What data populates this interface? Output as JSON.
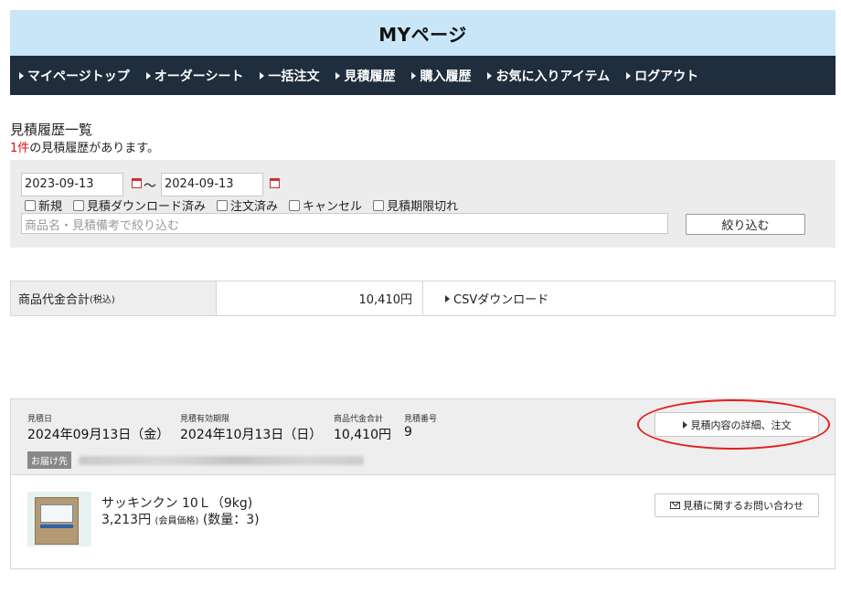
{
  "header": {
    "title": "MYページ"
  },
  "nav": {
    "items": [
      {
        "label": "マイページトップ"
      },
      {
        "label": "オーダーシート"
      },
      {
        "label": "一括注文"
      },
      {
        "label": "見積履歴"
      },
      {
        "label": "購入履歴"
      },
      {
        "label": "お気に入りアイテム"
      },
      {
        "label": "ログアウト"
      }
    ]
  },
  "page": {
    "heading": "見積履歴一覧",
    "count": "1件",
    "count_suffix": "の見積履歴があります。"
  },
  "filter": {
    "date_from": "2023-09-13",
    "tilde": "〜",
    "date_to": "2024-09-13",
    "statuses": [
      {
        "label": "新規",
        "checked": false
      },
      {
        "label": "見積ダウンロード済み",
        "checked": false
      },
      {
        "label": "注文済み",
        "checked": false
      },
      {
        "label": "キャンセル",
        "checked": false
      },
      {
        "label": "見積期限切れ",
        "checked": false
      }
    ],
    "search_placeholder": "商品名・見積備考で絞り込む",
    "button_label": "絞り込む"
  },
  "summary": {
    "label": "商品代金合計",
    "label_note": "(税込)",
    "value": "10,410円",
    "csv_label": "CSVダウンロード"
  },
  "order": {
    "quote_date_label": "見積日",
    "quote_date": "2024年09月13日（金）",
    "expiry_label": "見積有効期限",
    "expiry_date": "2024年10月13日（日）",
    "total_label": "商品代金合計",
    "total": "10,410円",
    "number_label": "見積番号",
    "number": "9",
    "detail_button": "見積内容の詳細、注文",
    "destination_label": "お届け先",
    "product": {
      "name": "サッキンクン 10Ｌ（9kg)",
      "price": "3,213円",
      "price_note": "(会員価格)",
      "quantity": "(数量：3)"
    },
    "inquiry_button": "見積に関するお問い合わせ"
  },
  "colors": {
    "header_bg": "#c8e6f8",
    "nav_bg": "#1f2d3d",
    "count_red": "#d11111",
    "annotation_red": "#e41e1e"
  }
}
